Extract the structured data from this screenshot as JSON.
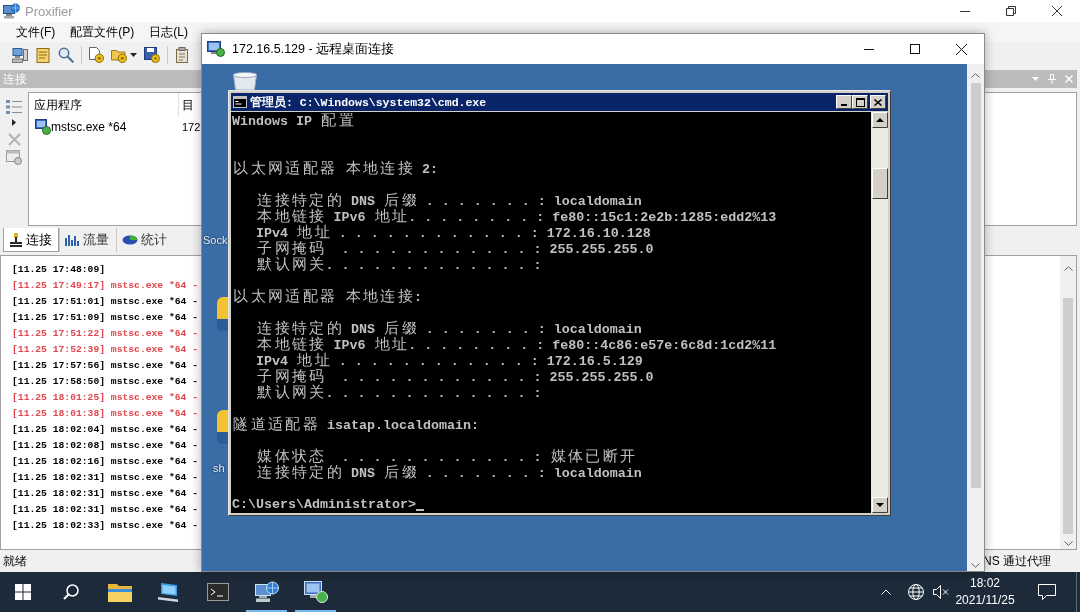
{
  "proxifier": {
    "title": "Proxifier",
    "menu": [
      "文件(F)",
      "配置文件(P)",
      "日志(L)"
    ],
    "panel_title": "连接",
    "connections": {
      "columns": [
        "应用程序",
        "目"
      ],
      "rows": [
        {
          "application": "mstsc.exe *64",
          "column_2": "172"
        }
      ]
    },
    "tabs": [
      {
        "label": "连接",
        "selected": true
      },
      {
        "label": "流量",
        "selected": false
      },
      {
        "label": "统计",
        "selected": false
      }
    ],
    "log": [
      {
        "text": "[11.25 17:48:09]",
        "color": "#000000"
      },
      {
        "text": "[11.25 17:49:17] mstsc.exe *64 -",
        "color": "#e0474c"
      },
      {
        "text": "[11.25 17:51:01] mstsc.exe *64 -",
        "color": "#000000"
      },
      {
        "text": "[11.25 17:51:09] mstsc.exe *64 -",
        "color": "#000000"
      },
      {
        "text": "[11.25 17:51:22] mstsc.exe *64 -",
        "color": "#e0474c"
      },
      {
        "text": "[11.25 17:52:39] mstsc.exe *64 -",
        "color": "#e0474c"
      },
      {
        "text": "[11.25 17:57:56] mstsc.exe *64 -",
        "color": "#000000"
      },
      {
        "text": "[11.25 17:58:50] mstsc.exe *64 -",
        "color": "#000000"
      },
      {
        "text": "[11.25 18:01:25] mstsc.exe *64 -",
        "color": "#e0474c"
      },
      {
        "text": "[11.25 18:01:38] mstsc.exe *64 -",
        "color": "#e0474c"
      },
      {
        "text": "[11.25 18:02:04] mstsc.exe *64 -",
        "color": "#000000"
      },
      {
        "text": "[11.25 18:02:08] mstsc.exe *64 -",
        "color": "#000000"
      },
      {
        "text": "[11.25 18:02:16] mstsc.exe *64 -",
        "color": "#000000"
      },
      {
        "text": "[11.25 18:02:31] mstsc.exe *64 -",
        "color": "#000000"
      },
      {
        "text": "[11.25 18:02:31] mstsc.exe *64 -",
        "color": "#000000"
      },
      {
        "text": "[11.25 18:02:31] mstsc.exe *64 -",
        "color": "#000000"
      },
      {
        "text": "[11.25 18:02:33] mstsc.exe *64 -",
        "color": "#000000"
      }
    ],
    "status_bar": {
      "left": "就绪",
      "right": "NS 通过代理"
    }
  },
  "remote_desktop": {
    "title": "172.16.5.129 - 远程桌面连接",
    "desktop_icons": [
      {
        "label": "Sock"
      },
      {
        "label": "sh"
      }
    ],
    "console": {
      "title": "管理员: C:\\Windows\\system32\\cmd.exe",
      "header": "Windows IP 配置",
      "sections": [
        {
          "heading": "以太网适配器 本地连接 2:",
          "lines": [
            "连接特定的 DNS 后缀 . . . . . . . : localdomain",
            "本地链接 IPv6 地址. . . . . . . . : fe80::15c1:2e2b:1285:edd2%13",
            "IPv4 地址 . . . . . . . . . . . . : 172.16.10.128",
            "子网掩码  . . . . . . . . . . . . : 255.255.255.0",
            "默认网关. . . . . . . . . . . . . :"
          ]
        },
        {
          "heading": "以太网适配器 本地连接:",
          "lines": [
            "连接特定的 DNS 后缀 . . . . . . . : localdomain",
            "本地链接 IPv6 地址. . . . . . . . : fe80::4c86:e57e:6c8d:1cd2%11",
            "IPv4 地址 . . . . . . . . . . . . : 172.16.5.129",
            "子网掩码  . . . . . . . . . . . . : 255.255.255.0",
            "默认网关. . . . . . . . . . . . . :"
          ]
        },
        {
          "heading": "隧道适配器 isatap.localdomain:",
          "lines": [
            "媒体状态  . . . . . . . . . . . . : 媒体已断开",
            "连接特定的 DNS 后缀 . . . . . . . : localdomain"
          ]
        }
      ],
      "prompt": "C:\\Users\\Administrator>"
    }
  },
  "taskbar": {
    "apps": [
      {
        "running": false
      },
      {
        "running": false
      },
      {
        "running": false
      },
      {
        "running": true
      },
      {
        "running": true
      }
    ],
    "time": "18:02",
    "date": "2021/11/25"
  }
}
